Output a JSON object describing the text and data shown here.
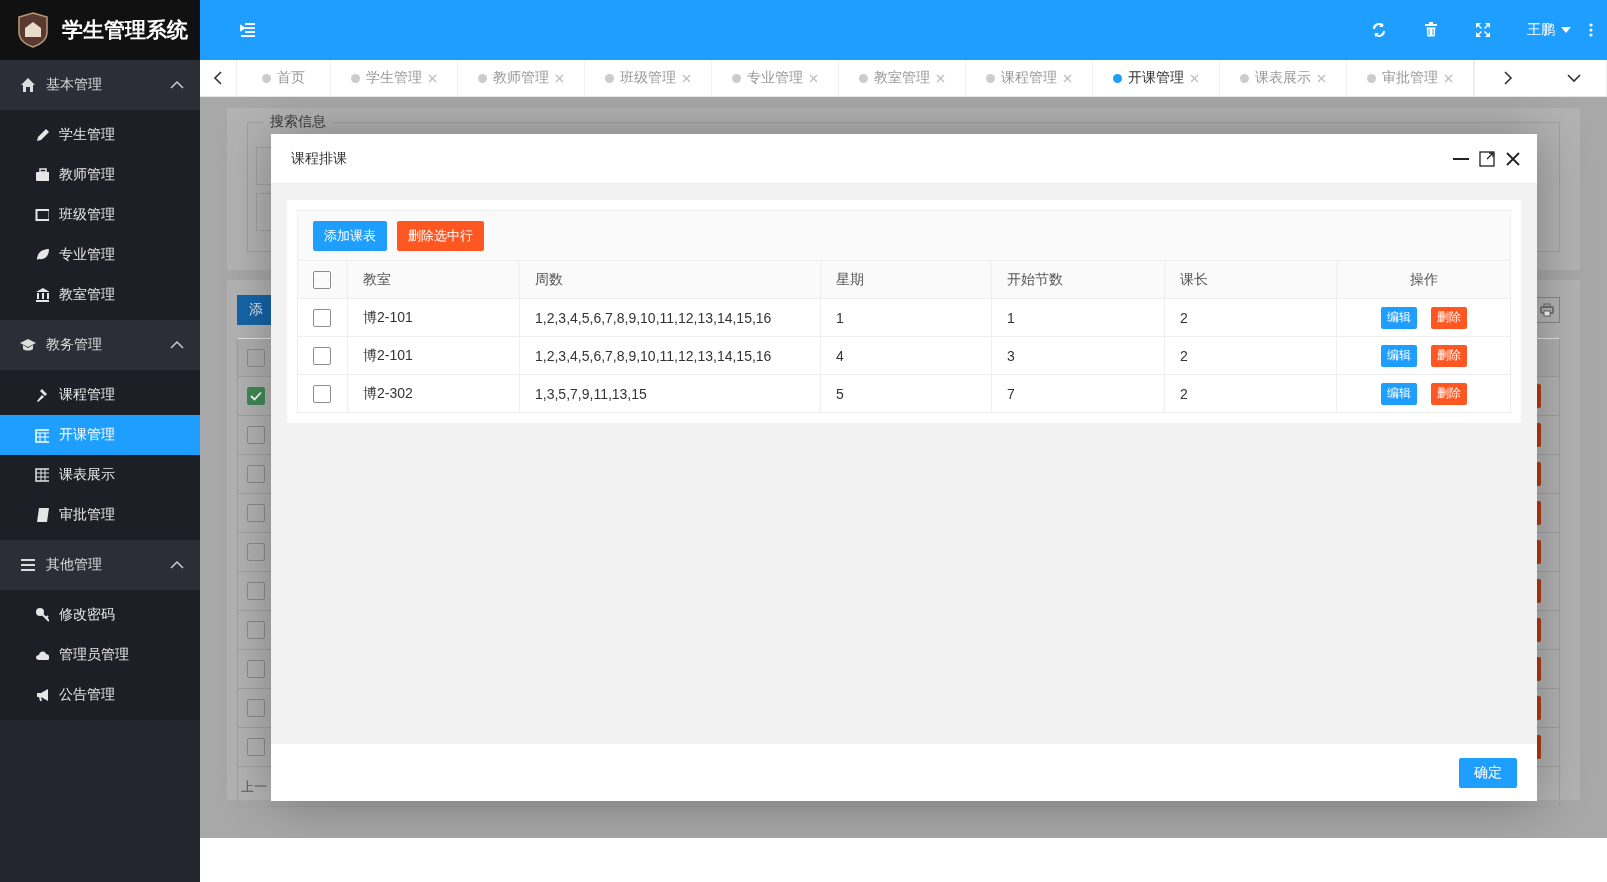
{
  "app": {
    "title": "学生管理系统"
  },
  "sidebar": {
    "groups": [
      {
        "label": "基本管理",
        "expanded": true,
        "items": [
          {
            "label": "学生管理",
            "selected": false
          },
          {
            "label": "教师管理",
            "selected": false
          },
          {
            "label": "班级管理",
            "selected": false
          },
          {
            "label": "专业管理",
            "selected": false
          },
          {
            "label": "教室管理",
            "selected": false
          }
        ]
      },
      {
        "label": "教务管理",
        "expanded": true,
        "items": [
          {
            "label": "课程管理",
            "selected": false
          },
          {
            "label": "开课管理",
            "selected": true
          },
          {
            "label": "课表展示",
            "selected": false
          },
          {
            "label": "审批管理",
            "selected": false
          }
        ]
      },
      {
        "label": "其他管理",
        "expanded": true,
        "items": [
          {
            "label": "修改密码",
            "selected": false
          },
          {
            "label": "管理员管理",
            "selected": false
          },
          {
            "label": "公告管理",
            "selected": false
          }
        ]
      }
    ]
  },
  "header": {
    "user": "王鹏"
  },
  "tabs": [
    {
      "label": "首页",
      "closable": false,
      "selected": false
    },
    {
      "label": "学生管理",
      "closable": true,
      "selected": false
    },
    {
      "label": "教师管理",
      "closable": true,
      "selected": false
    },
    {
      "label": "班级管理",
      "closable": true,
      "selected": false
    },
    {
      "label": "专业管理",
      "closable": true,
      "selected": false
    },
    {
      "label": "教室管理",
      "closable": true,
      "selected": false
    },
    {
      "label": "课程管理",
      "closable": true,
      "selected": false
    },
    {
      "label": "开课管理",
      "closable": true,
      "selected": true
    },
    {
      "label": "课表展示",
      "closable": true,
      "selected": false
    },
    {
      "label": "审批管理",
      "closable": true,
      "selected": false
    }
  ],
  "background": {
    "section_title": "搜索信息",
    "add_button": "添",
    "header_checked": false,
    "rows": [
      {
        "checked": true
      },
      {
        "checked": false
      },
      {
        "checked": false
      },
      {
        "checked": false
      },
      {
        "checked": false
      },
      {
        "checked": false
      },
      {
        "checked": false
      },
      {
        "checked": false
      },
      {
        "checked": false
      },
      {
        "checked": false
      }
    ],
    "pager": "上一"
  },
  "dialog": {
    "title": "课程排课",
    "add_button": "添加课表",
    "delete_button": "删除选中行",
    "header_checked": false,
    "columns": [
      "教室",
      "周数",
      "星期",
      "开始节数",
      "课长",
      "操作"
    ],
    "rows": [
      {
        "selected": false,
        "cells": [
          "博2-101",
          "1,2,3,4,5,6,7,8,9,10,11,12,13,14,15,16",
          "1",
          "1",
          "2"
        ],
        "edit": "编辑",
        "delete": "删除"
      },
      {
        "selected": false,
        "cells": [
          "博2-101",
          "1,2,3,4,5,6,7,8,9,10,11,12,13,14,15,16",
          "4",
          "3",
          "2"
        ],
        "edit": "编辑",
        "delete": "删除"
      },
      {
        "selected": false,
        "cells": [
          "博2-302",
          "1,3,5,7,9,11,13,15",
          "5",
          "7",
          "2"
        ],
        "edit": "编辑",
        "delete": "删除"
      }
    ],
    "confirm": "确定"
  }
}
